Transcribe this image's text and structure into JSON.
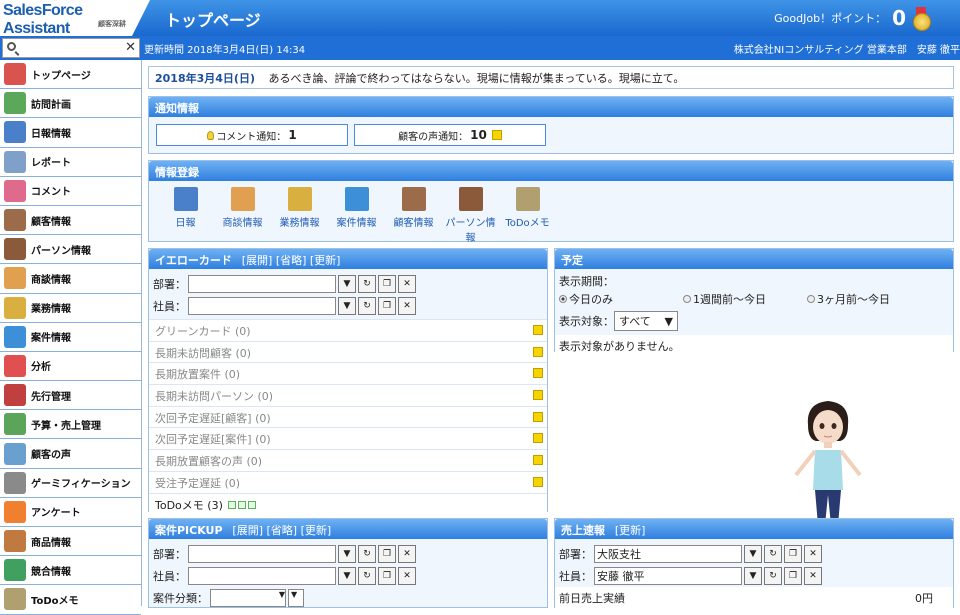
{
  "app": {
    "logo_main": "SalesForce Assistant",
    "logo_sub": "顧客深耕",
    "page_title": "トップページ",
    "points_label": "GoodJob！ポイント：",
    "points_value": "0",
    "updated": "更新時間 2018年3月4日(日) 14:34",
    "company": "株式会社NIコンサルティング 営業本部　安藤 徹平"
  },
  "sidebar": {
    "items": [
      {
        "label": "トップページ",
        "color": "#d9534f"
      },
      {
        "label": "訪問計画",
        "color": "#5ba85b"
      },
      {
        "label": "日報情報",
        "color": "#4a7fc9"
      },
      {
        "label": "レポート",
        "color": "#7fa1c9"
      },
      {
        "label": "コメント",
        "color": "#e06a8c"
      },
      {
        "label": "顧客情報",
        "color": "#9b6b4a"
      },
      {
        "label": "パーソン情報",
        "color": "#8a5a3a"
      },
      {
        "label": "商談情報",
        "color": "#e0a050"
      },
      {
        "label": "業務情報",
        "color": "#d9b040"
      },
      {
        "label": "案件情報",
        "color": "#3d8fd8"
      },
      {
        "label": "分析",
        "color": "#e05050"
      },
      {
        "label": "先行管理",
        "color": "#c04040"
      },
      {
        "label": "予算・売上管理",
        "color": "#5aa55a"
      },
      {
        "label": "顧客の声",
        "color": "#6aa0d0"
      },
      {
        "label": "ゲーミフィケーション",
        "color": "#8a8a8a"
      },
      {
        "label": "アンケート",
        "color": "#f08030"
      },
      {
        "label": "商品情報",
        "color": "#c07a40"
      },
      {
        "label": "競合情報",
        "color": "#40a060"
      },
      {
        "label": "ToDoメモ",
        "color": "#b0a070"
      }
    ]
  },
  "message": {
    "date": "2018年3月4日(日)",
    "text": "あるべき論、評論で終わってはならない。現場に情報が集まっている。現場に立て。"
  },
  "notice": {
    "title": "通知情報",
    "comment_label": "コメント通知：",
    "comment_count": "1",
    "voice_label": "顧客の声通知：",
    "voice_count": "10"
  },
  "register": {
    "title": "情報登録",
    "items": [
      {
        "label": "日報",
        "color": "#4a7fc9"
      },
      {
        "label": "商談情報",
        "color": "#e0a050"
      },
      {
        "label": "業務情報",
        "color": "#d9b040"
      },
      {
        "label": "案件情報",
        "color": "#3d8fd8"
      },
      {
        "label": "顧客情報",
        "color": "#9b6b4a"
      },
      {
        "label": "パーソン情報",
        "color": "#8a5a3a"
      },
      {
        "label": "ToDoメモ",
        "color": "#b0a070"
      }
    ]
  },
  "yellow": {
    "title": "イエローカード",
    "links": "[展開] [省略] [更新]",
    "dept_label": "部署：",
    "staff_label": "社員：",
    "items": [
      "グリーンカード (0)",
      "長期未訪問顧客 (0)",
      "長期放置案件 (0)",
      "長期未訪問パーソン (0)",
      "次回予定遅延[顧客] (0)",
      "次回予定遅延[案件] (0)",
      "長期放置顧客の声 (0)",
      "受注予定遅延 (0)"
    ],
    "todo": "ToDoメモ (3)"
  },
  "schedule": {
    "title": "予定",
    "period_label": "表示期間：",
    "opt1": "今日のみ",
    "opt2": "1週間前～今日",
    "opt3": "3ヶ月前～今日",
    "target_label": "表示対象：",
    "target_value": "すべて",
    "empty": "表示対象がありません。"
  },
  "pickup": {
    "title": "案件PICKUP",
    "links": "[展開] [省略] [更新]",
    "dept_label": "部署：",
    "staff_label": "社員：",
    "category_label": "案件分類："
  },
  "sales": {
    "title": "売上速報",
    "links": "[更新]",
    "dept_label": "部署：",
    "dept_value": "大阪支社",
    "staff_label": "社員：",
    "staff_value": "安藤 徹平",
    "prev_label": "前日売上実績",
    "prev_value": "0円"
  }
}
